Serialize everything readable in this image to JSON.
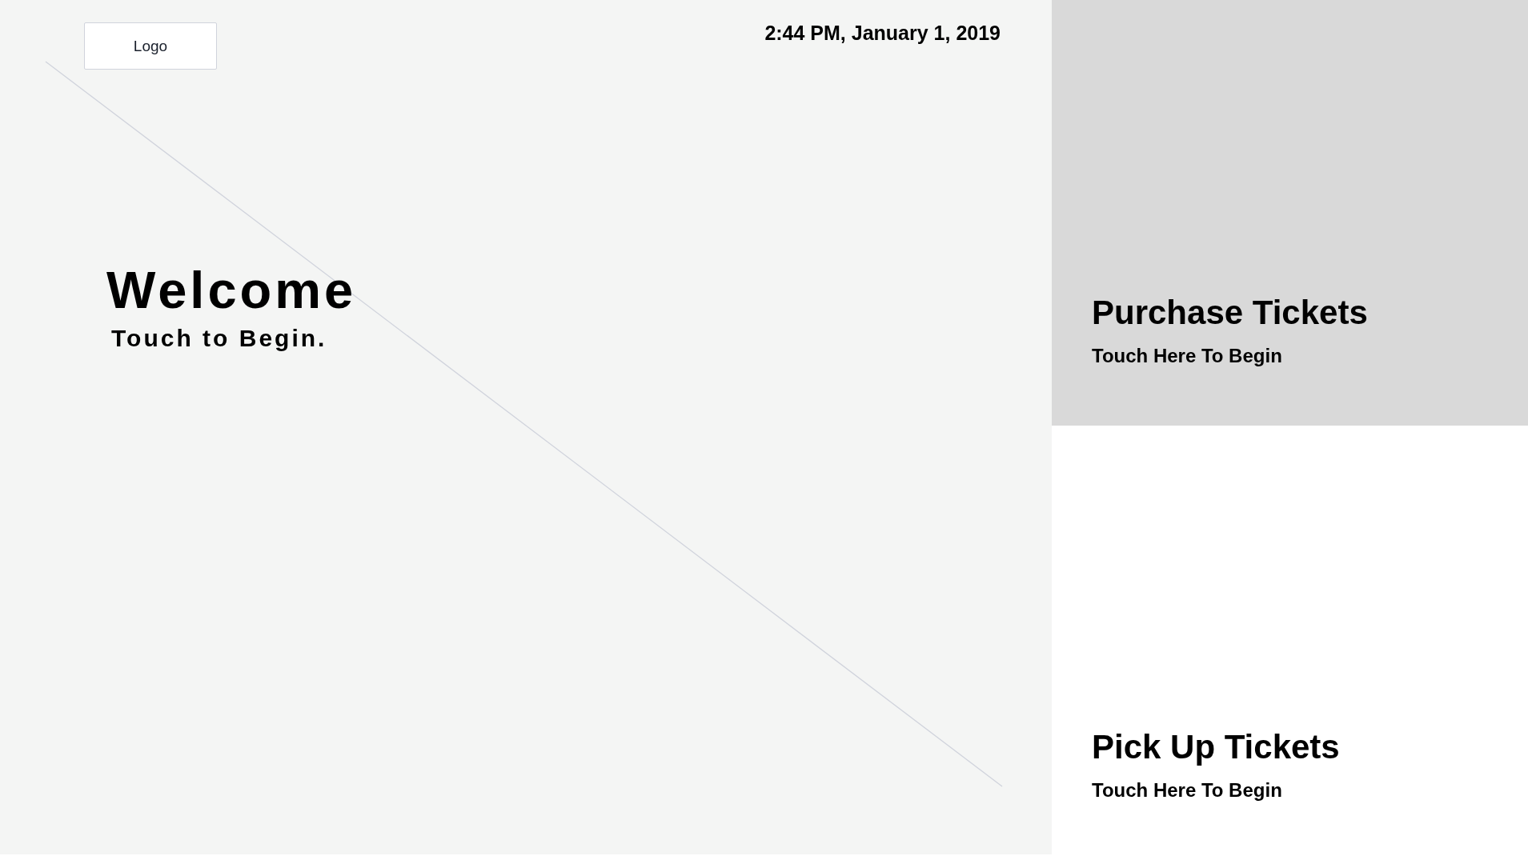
{
  "logo": {
    "label": "Logo"
  },
  "datetime": "2:44 PM, January 1, 2019",
  "welcome": {
    "title": "Welcome",
    "subtitle": "Touch to Begin."
  },
  "options": [
    {
      "title": "Purchase Tickets",
      "subtitle": "Touch Here To Begin",
      "selected": true
    },
    {
      "title": "Pick Up Tickets",
      "subtitle": "Touch Here To Begin",
      "selected": false
    }
  ]
}
